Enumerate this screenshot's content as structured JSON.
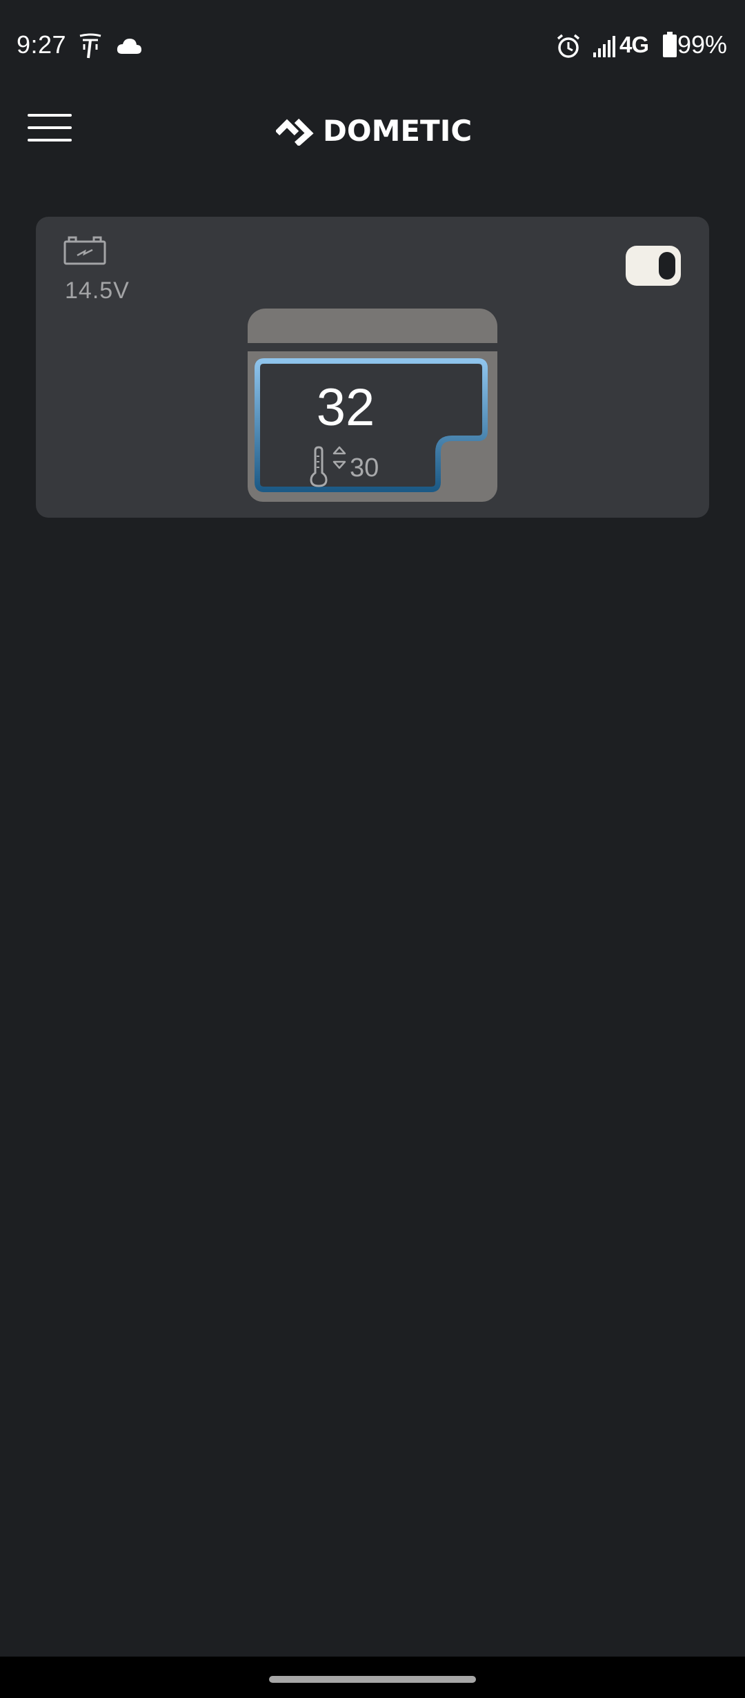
{
  "status_bar": {
    "time": "9:27",
    "network": "4G",
    "battery": "99%",
    "icons": [
      "tesla-icon",
      "cloud-icon",
      "alarm-icon",
      "signal-icon",
      "battery-icon"
    ]
  },
  "app_bar": {
    "logo_text": "DOMETIC",
    "menu_icon": "hamburger-menu-icon"
  },
  "device": {
    "voltage": "14.5V",
    "power_on": true,
    "current_temperature": "32",
    "setpoint_temperature": "30",
    "compartment_color_top": "#8fc4ec",
    "compartment_color_bottom": "#1c5a86"
  },
  "colors": {
    "background": "#1d1f22",
    "card": "#37393d",
    "fridge_gray": "#787674",
    "toggle": "#f2efe8"
  }
}
